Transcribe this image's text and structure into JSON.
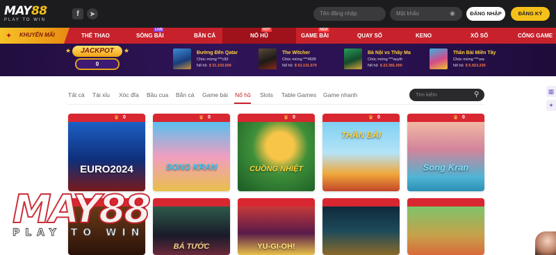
{
  "brand": {
    "logo_main": "MAY",
    "logo_accent": "88",
    "logo_sub": "PLAY TO WIN"
  },
  "header": {
    "social": [
      {
        "icon": "facebook-icon",
        "glyph": "f"
      },
      {
        "icon": "telegram-icon",
        "glyph": "➤"
      }
    ],
    "username_placeholder": "Tên đăng nhập",
    "password_placeholder": "Mật khẩu",
    "login_label": "ĐĂNG NHẬP",
    "register_label": "ĐĂNG KÝ"
  },
  "nav": {
    "promo_label": "KHUYẾN MÃI",
    "items": [
      {
        "label": "THỂ THAO"
      },
      {
        "label": "SÒNG BÀI",
        "badge": "LIVE"
      },
      {
        "label": "BẮN CÁ"
      },
      {
        "label": "NỔ HŨ",
        "badge": "HOT"
      },
      {
        "label": "GAME BÀI",
        "badge": "NEW"
      },
      {
        "label": "QUAY SỐ"
      },
      {
        "label": "KENO"
      },
      {
        "label": "XỔ SỐ"
      },
      {
        "label": "CỔNG GAME"
      }
    ],
    "active": "NỔ HŨ"
  },
  "jackpot": {
    "title": "JACKPOT",
    "value": "0",
    "winners": [
      {
        "game": "Đường Đến Qatar",
        "user_label": "Chúc mừng",
        "user": "***c92",
        "amount_label": "Nổ hũ",
        "amount": "$ 31.103.500"
      },
      {
        "game": "The Witcher",
        "user_label": "Chúc mừng",
        "user": "***4505",
        "amount_label": "Nổ hũ",
        "amount": "$ 53.131.570"
      },
      {
        "game": "Bà Nội vs Thây Ma",
        "user_label": "Chúc mừng",
        "user": "***auyth",
        "amount_label": "Nổ hũ",
        "amount": "$ 22.381.000"
      },
      {
        "game": "Thần Bài Miền Tây",
        "user_label": "Chúc mừng",
        "user": "***ura",
        "amount_label": "Nổ hũ",
        "amount": "$ 5.923.230"
      }
    ]
  },
  "filters": {
    "tabs": [
      "Tất cả",
      "Tài xỉu",
      "Xóc đĩa",
      "Bầu cua",
      "Bắn cá",
      "Game bài",
      "Nổ hũ",
      "Slots",
      "Table Games",
      "Game nhanh"
    ],
    "active": "Nổ hũ",
    "search_placeholder": "Tìm kiếm"
  },
  "games": [
    {
      "title": "EURO2024",
      "count": "0"
    },
    {
      "title": "SONG KRAN",
      "count": "0"
    },
    {
      "title": "CUỒNG NHIỆT",
      "count": "0"
    },
    {
      "title": "THẦN BÀI",
      "count": "0"
    },
    {
      "title": "Song Kran",
      "count": "0"
    },
    {
      "title": "",
      "count": ""
    },
    {
      "title": "BÁ TƯỚC",
      "count": ""
    },
    {
      "title": "YU-GI-OH!",
      "count": ""
    },
    {
      "title": "",
      "count": ""
    },
    {
      "title": "",
      "count": ""
    }
  ],
  "watermark": {
    "main": "MAY88",
    "sub": "PLAY TO WIN"
  }
}
